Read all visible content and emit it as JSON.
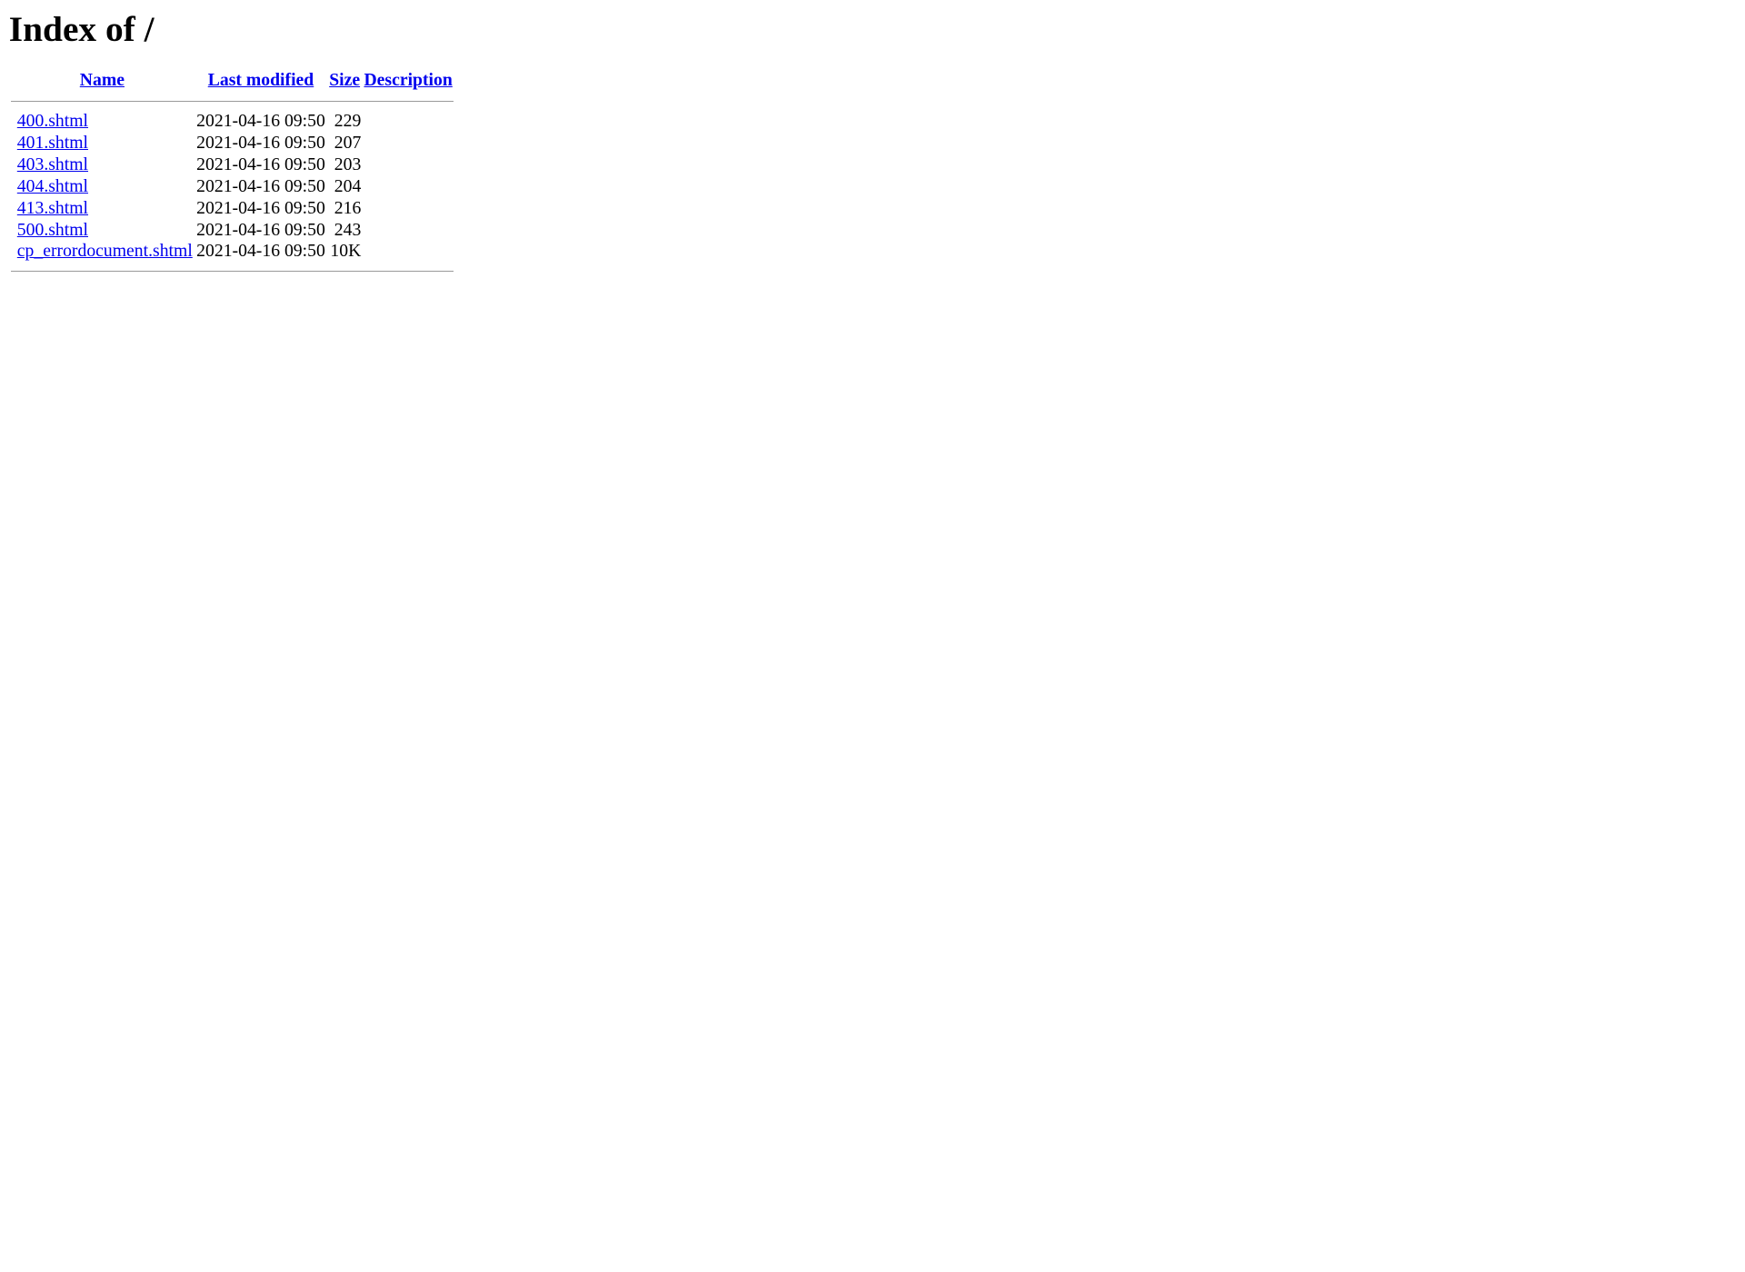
{
  "page": {
    "title": "Index of /"
  },
  "table": {
    "headers": {
      "name": "Name",
      "last_modified": "Last modified",
      "size": "Size",
      "description": "Description"
    },
    "rows": [
      {
        "name": "400.shtml",
        "modified": "2021-04-16 09:50",
        "size": "229",
        "description": ""
      },
      {
        "name": "401.shtml",
        "modified": "2021-04-16 09:50",
        "size": "207",
        "description": ""
      },
      {
        "name": "403.shtml",
        "modified": "2021-04-16 09:50",
        "size": "203",
        "description": ""
      },
      {
        "name": "404.shtml",
        "modified": "2021-04-16 09:50",
        "size": "204",
        "description": ""
      },
      {
        "name": "413.shtml",
        "modified": "2021-04-16 09:50",
        "size": "216",
        "description": ""
      },
      {
        "name": "500.shtml",
        "modified": "2021-04-16 09:50",
        "size": "243",
        "description": ""
      },
      {
        "name": "cp_errordocument.shtml",
        "modified": "2021-04-16 09:50",
        "size": "10K",
        "description": ""
      }
    ]
  },
  "colors": {
    "link": "#0000ee",
    "rule": "#9a9a9a",
    "text": "#000000",
    "background": "#ffffff"
  }
}
